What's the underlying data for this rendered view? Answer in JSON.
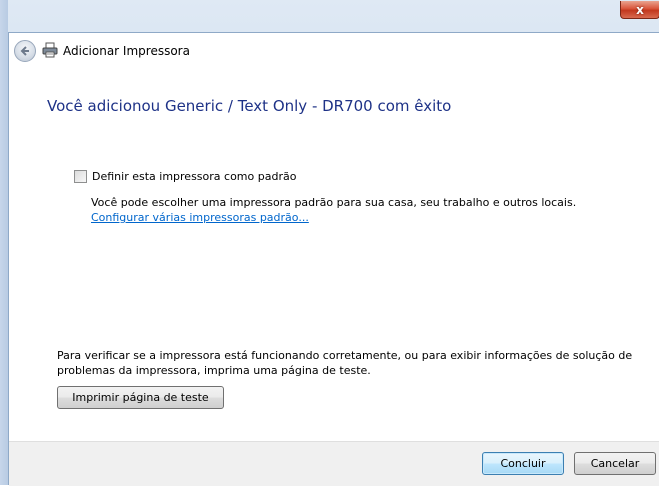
{
  "window": {
    "title": "Adicionar Impressora",
    "close_label": "x"
  },
  "main": {
    "headline": "Você adicionou Generic / Text Only - DR700 com êxito",
    "default_checkbox": {
      "label": "Definir esta impressora como padrão",
      "checked": false
    },
    "description": "Você pode escolher uma impressora padrão para sua casa, seu trabalho e outros locais.",
    "link": "Configurar várias impressoras padrão...",
    "verify_text": "Para verificar se a impressora está funcionando corretamente, ou para exibir informações de solução de problemas da impressora, imprima uma página de teste.",
    "test_button": "Imprimir página de teste"
  },
  "footer": {
    "finish_button": "Concluir",
    "cancel_button": "Cancelar"
  },
  "colors": {
    "headline": "#1e3287",
    "link": "#0066cc",
    "close_button": "#c2381e"
  },
  "icons": {
    "back": "back-arrow-icon",
    "printer": "printer-icon",
    "close": "close-icon"
  }
}
